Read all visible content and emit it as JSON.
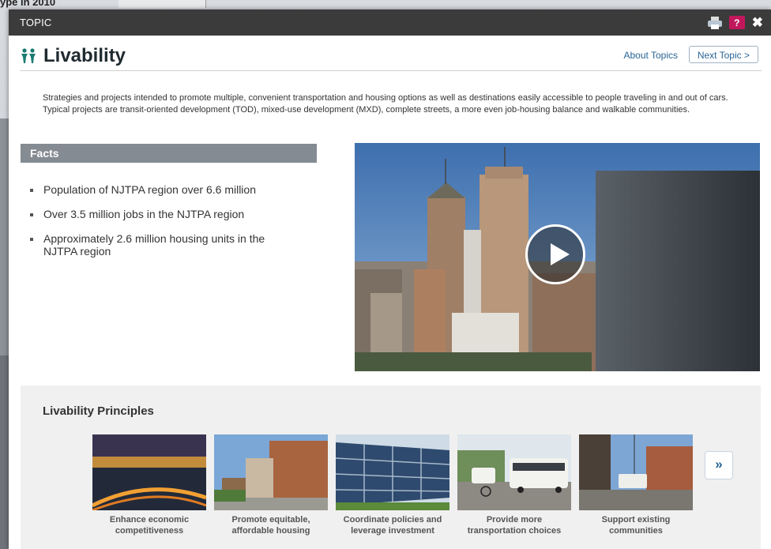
{
  "background": {
    "title_fragment": "ype in 2010"
  },
  "modal": {
    "header_title": "TOPIC",
    "help_label": "?",
    "close_label": "✖"
  },
  "topic": {
    "title": "Livability",
    "about_link": "About Topics",
    "next_button": "Next Topic >",
    "description": "Strategies and projects intended to promote multiple, convenient transportation and housing options as well as destinations easily accessible to people traveling in and out of cars. Typical projects are transit-oriented development (TOD), mixed-use development (MXD), complete streets, a more even job-housing balance and walkable communities."
  },
  "facts": {
    "heading": "Facts",
    "items": [
      "Population of NJTPA region over 6.6 million",
      "Over 3.5 million jobs in the NJTPA region",
      "Approximately 2.6 million housing units in the NJTPA region"
    ]
  },
  "principles": {
    "heading": "Livability Principles",
    "cards": [
      {
        "line1": "Enhance economic",
        "line2": "competitiveness"
      },
      {
        "line1": "Promote equitable,",
        "line2": "affordable housing"
      },
      {
        "line1": "Coordinate policies and",
        "line2": "leverage investment"
      },
      {
        "line1": "Provide more",
        "line2": "transportation choices"
      },
      {
        "line1": "Support existing",
        "line2": "communities"
      }
    ],
    "more_button": "»"
  },
  "colors": {
    "header_bg": "#3b3b3b",
    "facts_bar": "#858b92",
    "link": "#2a6496",
    "help_badge": "#c2185b",
    "principles_bg": "#f0f0f0"
  }
}
